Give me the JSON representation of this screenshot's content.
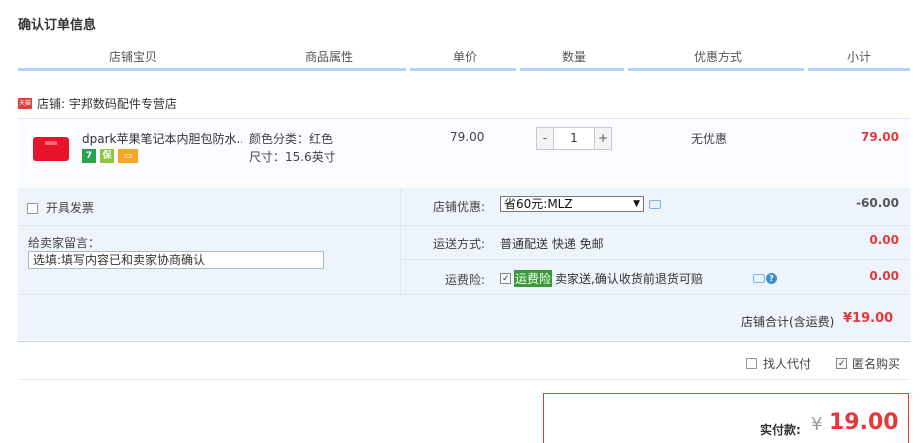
{
  "page_title": "确认订单信息",
  "columns": [
    "店铺宝贝",
    "商品属性",
    "单价",
    "数量",
    "优惠方式",
    "小计"
  ],
  "shop": {
    "badge": "天猫",
    "label": "店铺: 宇邦数码配件专营店"
  },
  "item": {
    "name": "dpark苹果笔记本内胆包防水...",
    "service_icons": [
      {
        "name": "seven-day-return-icon",
        "glyph": "7",
        "color": "#2aa34a"
      },
      {
        "name": "guarantee-icon",
        "glyph": "保",
        "color": "#8cc63f"
      },
      {
        "name": "credit-card-icon",
        "glyph": "▭",
        "color": "#f5a623"
      }
    ],
    "color_prop": "颜色分类：红色",
    "size_prop": "尺寸：15.6英寸",
    "unit_price": "79.00",
    "quantity": "1",
    "minus": "-",
    "plus": "+",
    "discount": "无优惠",
    "subtotal": "79.00"
  },
  "invoice": {
    "label": "开具发票"
  },
  "memo": {
    "label": "给卖家留言：",
    "value": "选填:填写内容已和卖家协商确认"
  },
  "shop_discount": {
    "label": "店铺优惠:",
    "selected": "省60元:MLZ",
    "amount": "-60.00"
  },
  "shipping": {
    "label": "运送方式:",
    "value": "普通配送 快递 免邮",
    "amount": "0.00"
  },
  "insurance": {
    "label": "运费险:",
    "tag": "运费险",
    "desc": "卖家送,确认收货前退货可赔",
    "help": "?",
    "amount": "0.00"
  },
  "shop_total": {
    "label": "店铺合计(含运费)",
    "amount": "¥19.00"
  },
  "options": {
    "proxy_pay": "找人代付",
    "anonymous": "匿名购买"
  },
  "payment": {
    "label": "实付款:",
    "currency": "¥",
    "amount": "19.00"
  },
  "colors": {
    "accent_red": "#e4393c",
    "header_bar": "#b2d1ff",
    "panel_bg": "#eef4fb"
  }
}
